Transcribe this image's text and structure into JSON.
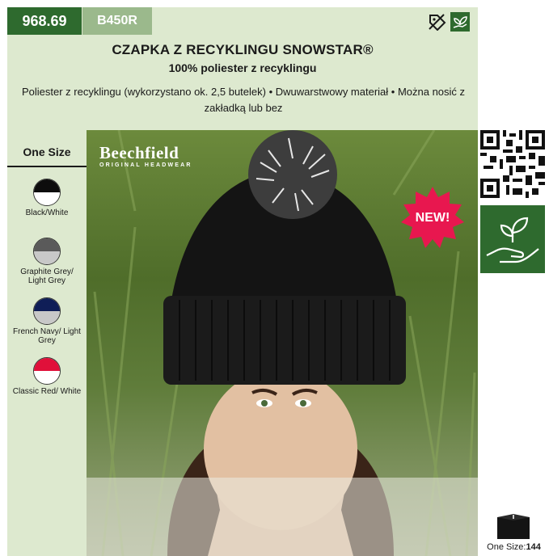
{
  "header": {
    "code_main": "968.69",
    "code_sub": "B450R",
    "icons": [
      "discount-tag-icon",
      "eco-leaf-icon"
    ],
    "title": "CZAPKA Z RECYKLINGU SNOWSTAR®",
    "subtitle": "100% poliester z recyklingu",
    "description": "Poliester z recyklingu (wykorzystano ok. 2,5 butelek) • Dwuwarstwowy materiał • Można nosić z zakładką lub bez"
  },
  "sizes": {
    "title": "One Size"
  },
  "colors": [
    {
      "label": "Black/White",
      "top": "#0d0d0d",
      "bottom": "#ffffff"
    },
    {
      "label": "Graphite Grey/ Light Grey",
      "top": "#5a5a5a",
      "bottom": "#c8c8c8"
    },
    {
      "label": "French Navy/ Light Grey",
      "top": "#0f1e57",
      "bottom": "#c8c8c8"
    },
    {
      "label": "Classic Red/ White",
      "top": "#e0103a",
      "bottom": "#ffffff"
    }
  ],
  "photo": {
    "brand": "Beechfield",
    "brand_tagline": "ORIGINAL HEADWEAR",
    "badge": "NEW!"
  },
  "packaging": {
    "label": "One Size:",
    "count": "144"
  },
  "theme": {
    "green_dark": "#2e6a2e",
    "green_light": "#dde9cf",
    "badge_red": "#e8174f"
  }
}
